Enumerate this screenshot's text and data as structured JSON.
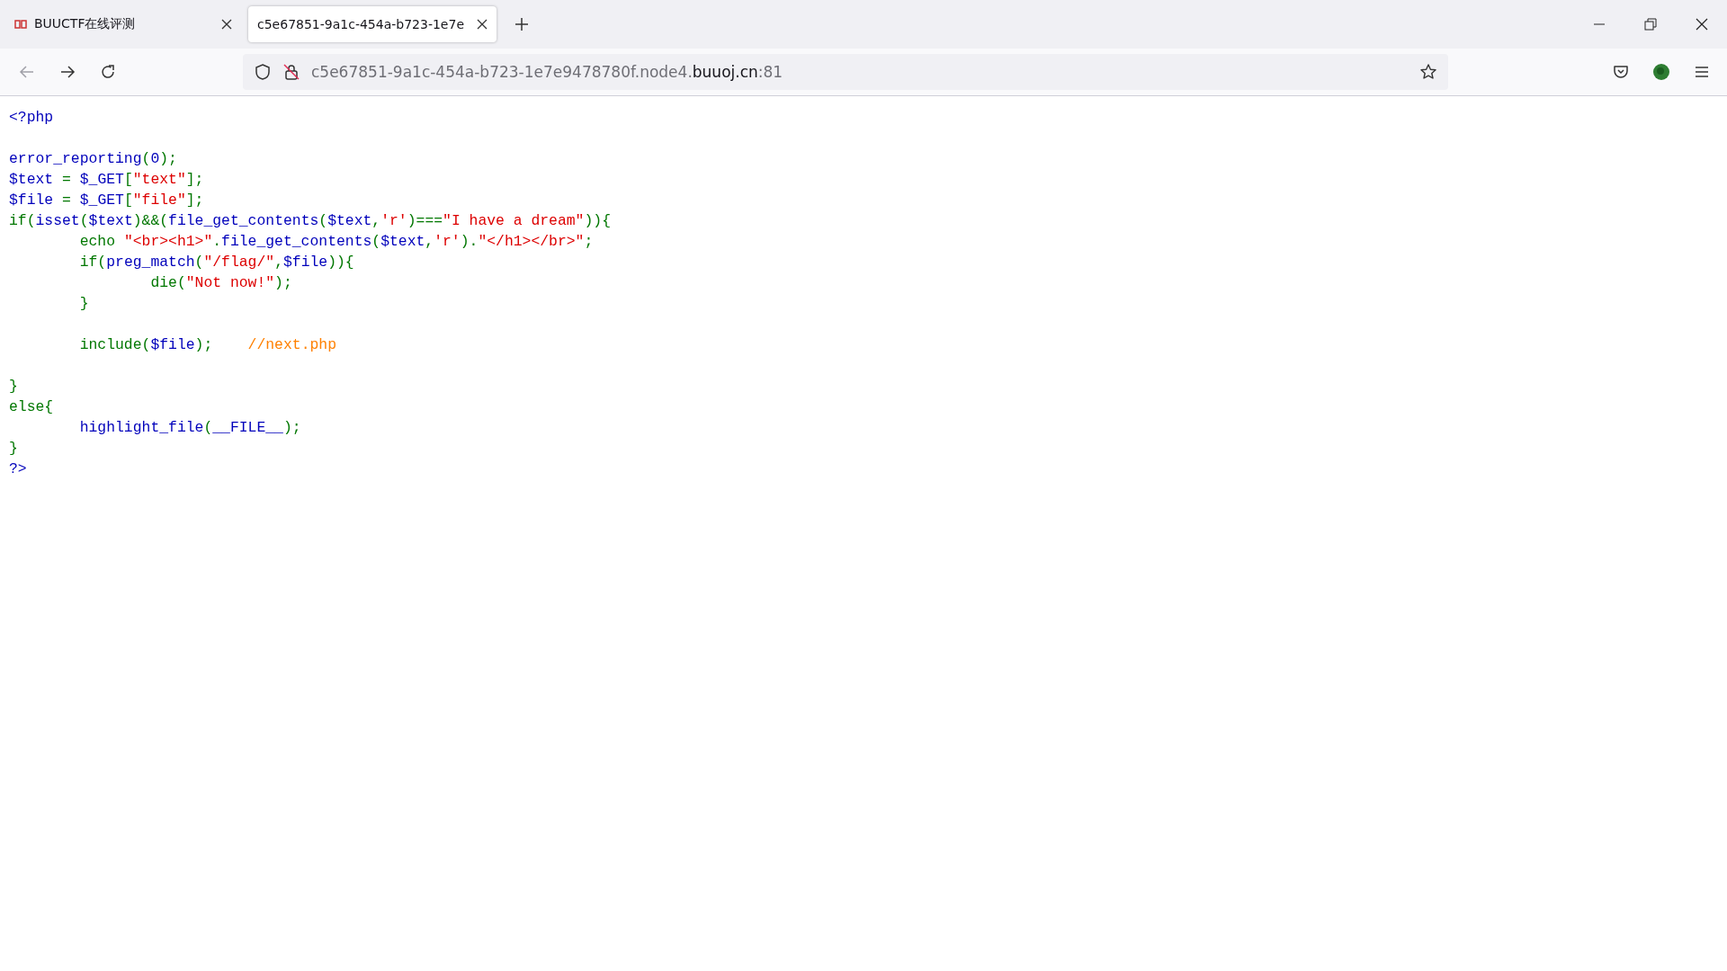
{
  "tabs": [
    {
      "title": "BUUCTF在线评测",
      "selected": false
    },
    {
      "title": "c5e67851-9a1c-454a-b723-1e7e",
      "selected": true
    }
  ],
  "address_bar": {
    "url_prefix": "c5e67851-9a1c-454a-b723-1e7e9478780f.node4.",
    "url_domain": "buuoj.cn",
    "url_suffix": ":81"
  },
  "code": {
    "lines": [
      {
        "tokens": [
          {
            "kind": "default",
            "text": "<?php"
          }
        ]
      },
      {
        "kind": "blank"
      },
      {
        "tokens": [
          {
            "kind": "default",
            "text": "error_reporting"
          },
          {
            "kind": "keyword",
            "text": "("
          },
          {
            "kind": "default",
            "text": "0"
          },
          {
            "kind": "keyword",
            "text": ");"
          }
        ]
      },
      {
        "tokens": [
          {
            "kind": "default",
            "text": "$text "
          },
          {
            "kind": "keyword",
            "text": "= "
          },
          {
            "kind": "default",
            "text": "$_GET"
          },
          {
            "kind": "keyword",
            "text": "["
          },
          {
            "kind": "string",
            "text": "\"text\""
          },
          {
            "kind": "keyword",
            "text": "];"
          }
        ]
      },
      {
        "tokens": [
          {
            "kind": "default",
            "text": "$file "
          },
          {
            "kind": "keyword",
            "text": "= "
          },
          {
            "kind": "default",
            "text": "$_GET"
          },
          {
            "kind": "keyword",
            "text": "["
          },
          {
            "kind": "string",
            "text": "\"file\""
          },
          {
            "kind": "keyword",
            "text": "];"
          }
        ]
      },
      {
        "tokens": [
          {
            "kind": "keyword",
            "text": "if("
          },
          {
            "kind": "default",
            "text": "isset"
          },
          {
            "kind": "keyword",
            "text": "("
          },
          {
            "kind": "default",
            "text": "$text"
          },
          {
            "kind": "keyword",
            "text": ")&&("
          },
          {
            "kind": "default",
            "text": "file_get_contents"
          },
          {
            "kind": "keyword",
            "text": "("
          },
          {
            "kind": "default",
            "text": "$text"
          },
          {
            "kind": "keyword",
            "text": ","
          },
          {
            "kind": "string",
            "text": "'r'"
          },
          {
            "kind": "keyword",
            "text": ")==="
          },
          {
            "kind": "string",
            "text": "\"I have a dream\""
          },
          {
            "kind": "keyword",
            "text": ")){"
          }
        ]
      },
      {
        "tokens": [
          {
            "kind": "keyword",
            "text": "        echo "
          },
          {
            "kind": "string",
            "text": "\"<br><h1>\""
          },
          {
            "kind": "keyword",
            "text": "."
          },
          {
            "kind": "default",
            "text": "file_get_contents"
          },
          {
            "kind": "keyword",
            "text": "("
          },
          {
            "kind": "default",
            "text": "$text"
          },
          {
            "kind": "keyword",
            "text": ","
          },
          {
            "kind": "string",
            "text": "'r'"
          },
          {
            "kind": "keyword",
            "text": ")."
          },
          {
            "kind": "string",
            "text": "\"</h1></br>\""
          },
          {
            "kind": "keyword",
            "text": ";"
          }
        ]
      },
      {
        "tokens": [
          {
            "kind": "keyword",
            "text": "        if("
          },
          {
            "kind": "default",
            "text": "preg_match"
          },
          {
            "kind": "keyword",
            "text": "("
          },
          {
            "kind": "string",
            "text": "\"/flag/\""
          },
          {
            "kind": "keyword",
            "text": ","
          },
          {
            "kind": "default",
            "text": "$file"
          },
          {
            "kind": "keyword",
            "text": ")){"
          }
        ]
      },
      {
        "tokens": [
          {
            "kind": "keyword",
            "text": "                die("
          },
          {
            "kind": "string",
            "text": "\"Not now!\""
          },
          {
            "kind": "keyword",
            "text": ");"
          }
        ]
      },
      {
        "tokens": [
          {
            "kind": "keyword",
            "text": "        }"
          }
        ]
      },
      {
        "kind": "blank"
      },
      {
        "tokens": [
          {
            "kind": "keyword",
            "text": "        include("
          },
          {
            "kind": "default",
            "text": "$file"
          },
          {
            "kind": "keyword",
            "text": ");    "
          },
          {
            "kind": "comment",
            "text": "//next.php"
          }
        ]
      },
      {
        "kind": "blank"
      },
      {
        "tokens": [
          {
            "kind": "keyword",
            "text": "}"
          }
        ]
      },
      {
        "tokens": [
          {
            "kind": "keyword",
            "text": "else{"
          }
        ]
      },
      {
        "tokens": [
          {
            "kind": "default",
            "text": "        highlight_file"
          },
          {
            "kind": "keyword",
            "text": "("
          },
          {
            "kind": "default",
            "text": "__FILE__"
          },
          {
            "kind": "keyword",
            "text": ");"
          }
        ]
      },
      {
        "tokens": [
          {
            "kind": "keyword",
            "text": "}"
          }
        ]
      },
      {
        "tokens": [
          {
            "kind": "default",
            "text": "?>"
          }
        ]
      }
    ]
  }
}
